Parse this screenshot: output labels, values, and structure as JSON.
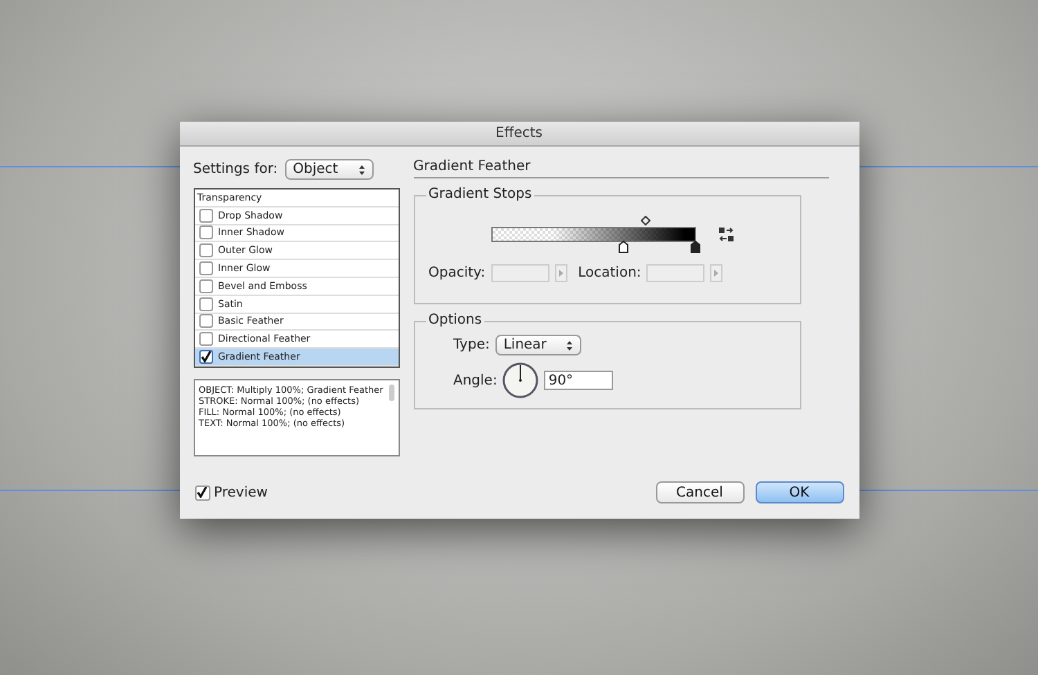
{
  "window": {
    "title": "Effects"
  },
  "settings_for": {
    "label": "Settings for:",
    "value": "Object"
  },
  "effects": [
    {
      "label": "Transparency",
      "kind": "header",
      "selected": false
    },
    {
      "label": "Drop Shadow",
      "kind": "effect",
      "checked": false,
      "selected": false
    },
    {
      "label": "Inner Shadow",
      "kind": "effect",
      "checked": false,
      "selected": false
    },
    {
      "label": "Outer Glow",
      "kind": "effect",
      "checked": false,
      "selected": false
    },
    {
      "label": "Inner Glow",
      "kind": "effect",
      "checked": false,
      "selected": false
    },
    {
      "label": "Bevel and Emboss",
      "kind": "effect",
      "checked": false,
      "selected": false
    },
    {
      "label": "Satin",
      "kind": "effect",
      "checked": false,
      "selected": false
    },
    {
      "label": "Basic Feather",
      "kind": "effect",
      "checked": false,
      "selected": false
    },
    {
      "label": "Directional Feather",
      "kind": "effect",
      "checked": false,
      "selected": false
    },
    {
      "label": "Gradient Feather",
      "kind": "effect",
      "checked": true,
      "selected": true
    }
  ],
  "summary": [
    "OBJECT: Multiply 100%; Gradient Feather",
    "STROKE: Normal 100%; (no effects)",
    "FILL: Normal 100%; (no effects)",
    "TEXT: Normal 100%; (no effects)"
  ],
  "panel_title": "Gradient Feather",
  "gradient_stops": {
    "title": "Gradient Stops",
    "opacity_label": "Opacity:",
    "location_label": "Location:",
    "midpoint": {
      "level": 0.75
    },
    "stops": [
      {
        "level": 0.65,
        "selected": false
      },
      {
        "level": 1.0,
        "selected": true
      }
    ]
  },
  "options": {
    "title": "Options",
    "type_label": "Type:",
    "type_value": "Linear",
    "angle_label": "Angle:",
    "angle_value": "90°"
  },
  "preview": {
    "label": "Preview",
    "checked": true
  },
  "buttons": [
    {
      "label": "Cancel",
      "default": false
    },
    {
      "label": "OK",
      "default": true
    }
  ]
}
